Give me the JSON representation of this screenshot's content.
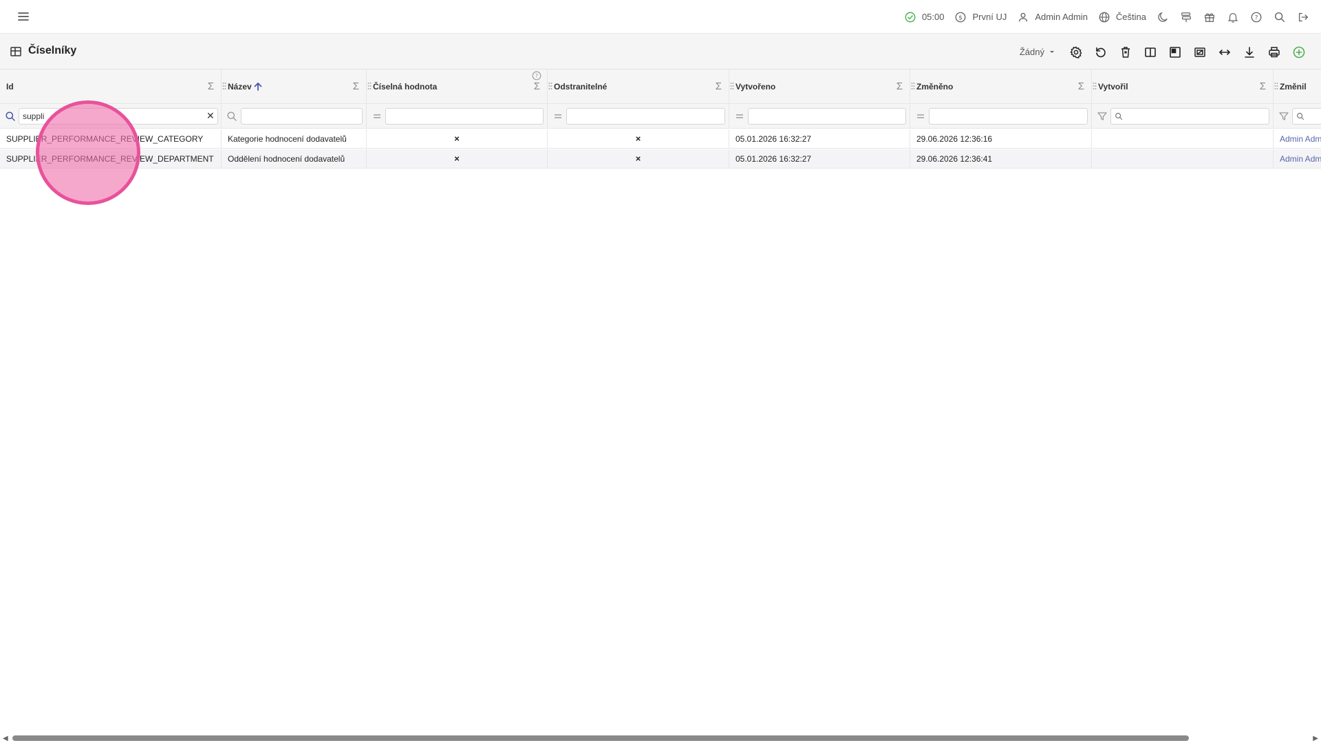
{
  "topbar": {
    "status_time": "05:00",
    "company": "První UJ",
    "user": "Admin Admin",
    "language": "Čeština"
  },
  "page": {
    "title": "Číselníky",
    "preset_label": "Žádný"
  },
  "columns": [
    {
      "label": "Id"
    },
    {
      "label": "Název"
    },
    {
      "label": "Číselná hodnota"
    },
    {
      "label": "Odstranitelné"
    },
    {
      "label": "Vytvořeno"
    },
    {
      "label": "Změněno"
    },
    {
      "label": "Vytvořil"
    },
    {
      "label": "Změnil"
    }
  ],
  "filters": {
    "id_value": "suppli"
  },
  "rows": [
    {
      "id": "SUPPLIER_PERFORMANCE_REVIEW_CATEGORY",
      "name": "Kategorie hodnocení dodavatelů",
      "numeric": "×",
      "removable": "×",
      "created": "05.01.2026 16:32:27",
      "changed": "29.06.2026 12:36:16",
      "created_by": "",
      "changed_by": "Admin Admin"
    },
    {
      "id": "SUPPLIER_PERFORMANCE_REVIEW_DEPARTMENT",
      "name": "Oddělení hodnocení dodavatelů",
      "numeric": "×",
      "removable": "×",
      "created": "05.01.2026 16:32:27",
      "changed": "29.06.2026 12:36:41",
      "created_by": "",
      "changed_by": "Admin Admin"
    }
  ],
  "colors": {
    "accent": "#5a66a8",
    "success": "#4caf50",
    "highlight": "#e8529a"
  }
}
